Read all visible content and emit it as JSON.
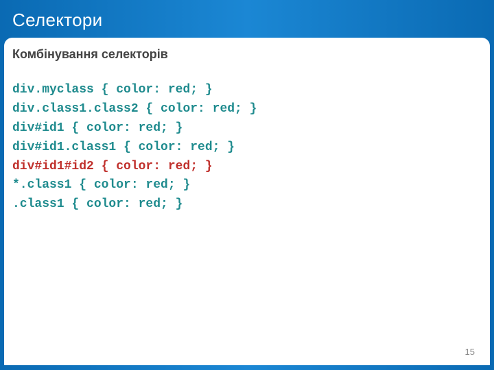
{
  "slide": {
    "title": "Селектори",
    "subheading": "Комбінування селекторів",
    "codeLines": [
      {
        "text": "div.myclass { color: red; }",
        "variant": "teal"
      },
      {
        "text": "div.class1.class2 { color: red; }",
        "variant": "teal"
      },
      {
        "text": "div#id1 { color: red; }",
        "variant": "teal"
      },
      {
        "text": "div#id1.class1 { color: red; }",
        "variant": "teal"
      },
      {
        "text": "div#id1#id2 { color: red; }",
        "variant": "red"
      },
      {
        "text": "*.class1 { color: red; }",
        "variant": "teal"
      },
      {
        "text": ".class1 { color: red; }",
        "variant": "teal"
      }
    ],
    "pageNumber": "15"
  }
}
